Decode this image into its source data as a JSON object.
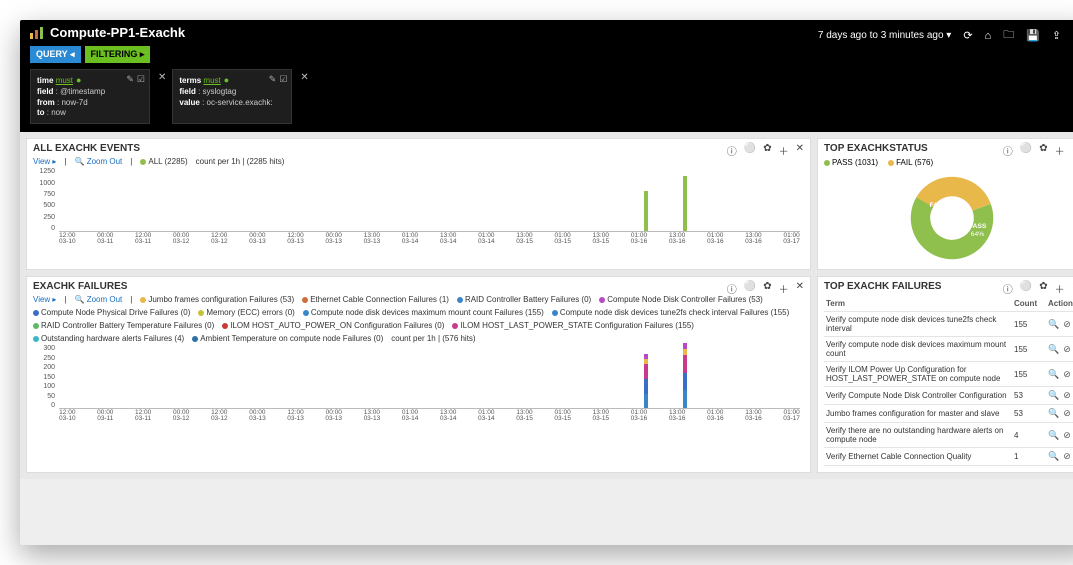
{
  "header": {
    "title": "Compute-PP1-Exachk",
    "timerange": "7 days ago to 3 minutes ago",
    "pills": {
      "query": "QUERY ◂",
      "filtering": "FILTERING ▸"
    }
  },
  "filters": [
    {
      "title_left": "time",
      "title_right": "must",
      "lines": {
        "field": "@timestamp",
        "from": "now-7d",
        "to": "now"
      }
    },
    {
      "title_left": "terms",
      "title_right": "must",
      "lines": {
        "field": "syslogtag",
        "value": "oc-service.exachk:"
      }
    }
  ],
  "panel_all": {
    "title": "ALL EXACHK EVENTS",
    "view": "View ▸",
    "zoom": "Zoom Out",
    "legend_all": "ALL (2285)",
    "count_label": "count per 1h | (2285 hits)"
  },
  "panel_status": {
    "title": "TOP EXACHKSTATUS",
    "legend": [
      {
        "label": "PASS (1031)",
        "color": "#8fbf4d"
      },
      {
        "label": "FAIL (576)",
        "color": "#e9b84a"
      }
    ],
    "donut": {
      "pass_pct": "64%",
      "pass_label": "PASS",
      "fail_pct": "36%",
      "fail_label": "FAIL"
    }
  },
  "panel_fail": {
    "title": "EXACHK FAILURES",
    "view": "View ▸",
    "zoom": "Zoom Out",
    "tail": "count per 1h | (576 hits)",
    "series": [
      {
        "label": "Jumbo frames configuration Failures (53)",
        "color": "#e9b84a"
      },
      {
        "label": "Ethernet Cable Connection Failures (1)",
        "color": "#d06b3e"
      },
      {
        "label": "RAID Controller Battery Failures (0)",
        "color": "#3a87c8"
      },
      {
        "label": "Compute Node Disk Controller Failures (53)",
        "color": "#b84ac5"
      },
      {
        "label": "Compute Node Physical Drive Failures (0)",
        "color": "#3a6fc8"
      },
      {
        "label": "Memory (ECC) errors (0)",
        "color": "#c6c23a"
      },
      {
        "label": "Compute node disk devices maximum mount count Failures (155)",
        "color": "#3a87c8"
      },
      {
        "label": "Compute node disk devices tune2fs check interval Failures (155)",
        "color": "#3a87c8"
      },
      {
        "label": "RAID Controller Battery Temperature Failures (0)",
        "color": "#5dbb63"
      },
      {
        "label": "ILOM HOST_AUTO_POWER_ON Configuration Failures (0)",
        "color": "#c83a3a"
      },
      {
        "label": "ILOM HOST_LAST_POWER_STATE Configuration Failures (155)",
        "color": "#c83a8b"
      },
      {
        "label": "Outstanding hardware alerts Failures (4)",
        "color": "#3ab7c8"
      },
      {
        "label": "Ambient Temperature on compute node Failures (0)",
        "color": "#2f6fa8"
      }
    ]
  },
  "panel_topfail": {
    "title": "TOP EXACHK FAILURES",
    "cols": {
      "term": "Term",
      "count": "Count",
      "action": "Action"
    },
    "rows": [
      {
        "term": "Verify compute node disk devices tune2fs check interval",
        "count": "155"
      },
      {
        "term": "Verify compute node disk devices maximum mount count",
        "count": "155"
      },
      {
        "term": "Verify ILOM Power Up Configuration for HOST_LAST_POWER_STATE on compute node",
        "count": "155"
      },
      {
        "term": "Verify Compute Node Disk Controller Configuration",
        "count": "53"
      },
      {
        "term": "Jumbo frames configuration for master and slave",
        "count": "53"
      },
      {
        "term": "Verify there are no outstanding hardware alerts on compute node",
        "count": "4"
      },
      {
        "term": "Verify Ethernet Cable Connection Quality",
        "count": "1"
      }
    ]
  },
  "chart_data": [
    {
      "type": "bar",
      "title": "ALL EXACHK EVENTS",
      "xlabel": "",
      "ylabel": "count",
      "ylim": [
        0,
        1250
      ],
      "categories": [
        "12:00 03-10",
        "00:00 03-11",
        "12:00 03-11",
        "00:00 03-12",
        "12:00 03-12",
        "00:00 03-13",
        "12:00 03-13",
        "00:00 03-13",
        "13:00 03-13",
        "01:00 03-14",
        "13:00 03-14",
        "01:00 03-14",
        "13:00 03-15",
        "01:00 03-15",
        "13:00 03-15",
        "01:00 03-16",
        "13:00 03-16",
        "01:00 03-16",
        "13:00 03-16",
        "01:00 03-17"
      ],
      "values": [
        0,
        0,
        0,
        0,
        0,
        0,
        0,
        0,
        0,
        0,
        0,
        0,
        0,
        0,
        0,
        800,
        1100,
        0,
        0,
        0
      ],
      "series_name": "ALL"
    },
    {
      "type": "bar",
      "title": "EXACHK FAILURES",
      "xlabel": "",
      "ylabel": "count",
      "ylim": [
        0,
        300
      ],
      "categories": [
        "12:00 03-10",
        "00:00 03-11",
        "12:00 03-11",
        "00:00 03-12",
        "12:00 03-12",
        "00:00 03-13",
        "12:00 03-13",
        "00:00 03-13",
        "13:00 03-13",
        "01:00 03-14",
        "13:00 03-14",
        "01:00 03-14",
        "13:00 03-15",
        "01:00 03-15",
        "13:00 03-15",
        "01:00 03-16",
        "13:00 03-16",
        "01:00 03-16",
        "13:00 03-16",
        "01:00 03-17"
      ],
      "series": [
        {
          "name": "tune2fs check interval",
          "color": "#3a87c8",
          "values": [
            0,
            0,
            0,
            0,
            0,
            0,
            0,
            0,
            0,
            0,
            0,
            0,
            0,
            0,
            0,
            70,
            85,
            0,
            0,
            0
          ]
        },
        {
          "name": "maximum mount count",
          "color": "#3a6fc8",
          "values": [
            0,
            0,
            0,
            0,
            0,
            0,
            0,
            0,
            0,
            0,
            0,
            0,
            0,
            0,
            0,
            70,
            85,
            0,
            0,
            0
          ]
        },
        {
          "name": "HOST_LAST_POWER_STATE",
          "color": "#c83a8b",
          "values": [
            0,
            0,
            0,
            0,
            0,
            0,
            0,
            0,
            0,
            0,
            0,
            0,
            0,
            0,
            0,
            70,
            85,
            0,
            0,
            0
          ]
        },
        {
          "name": "Jumbo frames",
          "color": "#e9b84a",
          "values": [
            0,
            0,
            0,
            0,
            0,
            0,
            0,
            0,
            0,
            0,
            0,
            0,
            0,
            0,
            0,
            25,
            28,
            0,
            0,
            0
          ]
        },
        {
          "name": "Disk Controller",
          "color": "#b84ac5",
          "values": [
            0,
            0,
            0,
            0,
            0,
            0,
            0,
            0,
            0,
            0,
            0,
            0,
            0,
            0,
            0,
            25,
            28,
            0,
            0,
            0
          ]
        }
      ]
    },
    {
      "type": "pie",
      "title": "TOP EXACHKSTATUS",
      "series": [
        {
          "name": "PASS",
          "value": 1031,
          "pct": 64,
          "color": "#8fbf4d"
        },
        {
          "name": "FAIL",
          "value": 576,
          "pct": 36,
          "color": "#e9b84a"
        }
      ]
    }
  ],
  "xticks": [
    {
      "t": "12:00",
      "d": "03-10"
    },
    {
      "t": "00:00",
      "d": "03-11"
    },
    {
      "t": "12:00",
      "d": "03-11"
    },
    {
      "t": "00:00",
      "d": "03-12"
    },
    {
      "t": "12:00",
      "d": "03-12"
    },
    {
      "t": "00:00",
      "d": "03-13"
    },
    {
      "t": "12:00",
      "d": "03-13"
    },
    {
      "t": "00:00",
      "d": "03-13"
    },
    {
      "t": "13:00",
      "d": "03-13"
    },
    {
      "t": "01:00",
      "d": "03-14"
    },
    {
      "t": "13:00",
      "d": "03-14"
    },
    {
      "t": "01:00",
      "d": "03-14"
    },
    {
      "t": "13:00",
      "d": "03-15"
    },
    {
      "t": "01:00",
      "d": "03-15"
    },
    {
      "t": "13:00",
      "d": "03-15"
    },
    {
      "t": "01:00",
      "d": "03-16"
    },
    {
      "t": "13:00",
      "d": "03-16"
    },
    {
      "t": "01:00",
      "d": "03-16"
    },
    {
      "t": "13:00",
      "d": "03-16"
    },
    {
      "t": "01:00",
      "d": "03-17"
    }
  ],
  "yticks_all": [
    "1250",
    "1000",
    "750",
    "500",
    "250",
    "0"
  ],
  "yticks_fail": [
    "300",
    "250",
    "200",
    "150",
    "100",
    "50",
    "0"
  ]
}
